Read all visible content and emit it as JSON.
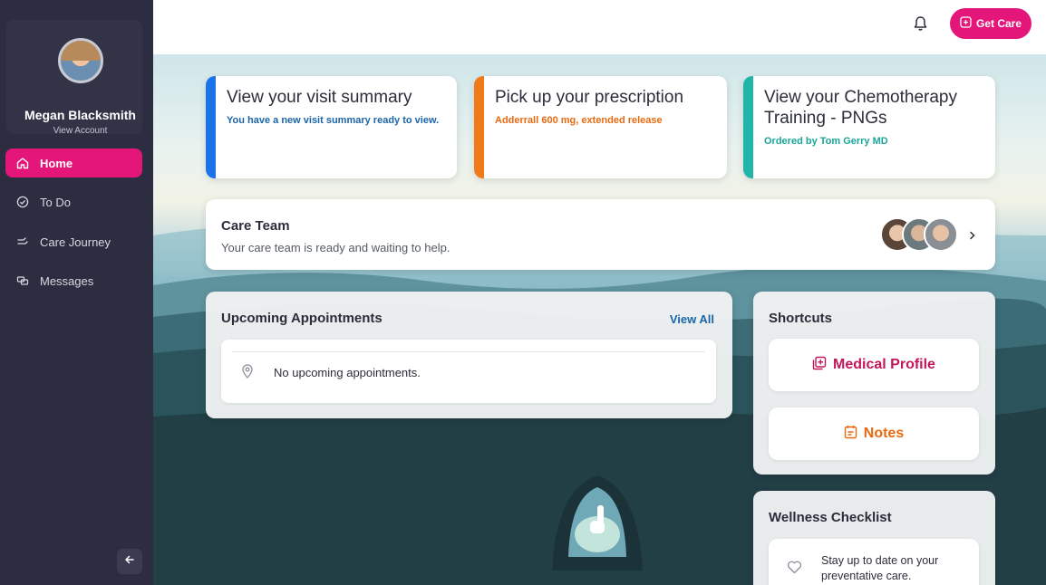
{
  "user": {
    "name": "Megan Blacksmith",
    "view_account": "View Account"
  },
  "nav": {
    "items": [
      {
        "label": "Home",
        "icon": "home-icon",
        "active": true
      },
      {
        "label": "To Do",
        "icon": "check-circle-icon",
        "active": false
      },
      {
        "label": "Care Journey",
        "icon": "journey-icon",
        "active": false
      },
      {
        "label": "Messages",
        "icon": "messages-icon",
        "active": false
      }
    ]
  },
  "header": {
    "get_care_label": "Get Care"
  },
  "cards": [
    {
      "title": "View your visit summary",
      "subtitle": "You have a new visit summary ready to view.",
      "accent": "#1a73e8",
      "subtitle_color": "#1a64a8"
    },
    {
      "title": "Pick up your prescription",
      "subtitle": "Adderrall 600 mg, extended release",
      "accent": "#f07a1a",
      "subtitle_color": "#e86a10"
    },
    {
      "title": "View your Chemotherapy Training - PNGs",
      "subtitle": "Ordered by Tom Gerry MD",
      "accent": "#1fb5a8",
      "subtitle_color": "#1aa59a"
    }
  ],
  "care_team": {
    "title": "Care Team",
    "subtitle": "Your care team is ready and waiting to help."
  },
  "appointments": {
    "title": "Upcoming Appointments",
    "view_all": "View All",
    "empty_text": "No upcoming appointments."
  },
  "shortcuts": {
    "title": "Shortcuts",
    "items": [
      {
        "label": "Medical Profile",
        "icon": "medical-profile-icon",
        "color": "#c2185b"
      },
      {
        "label": "Notes",
        "icon": "notes-icon",
        "color": "#e86a10"
      }
    ]
  },
  "wellness": {
    "title": "Wellness Checklist",
    "item_text": "Stay up to date on your preventative care."
  },
  "colors": {
    "brand_pink": "#e5167a",
    "sidebar": "#2c2d41",
    "link_blue": "#1a64a8"
  }
}
